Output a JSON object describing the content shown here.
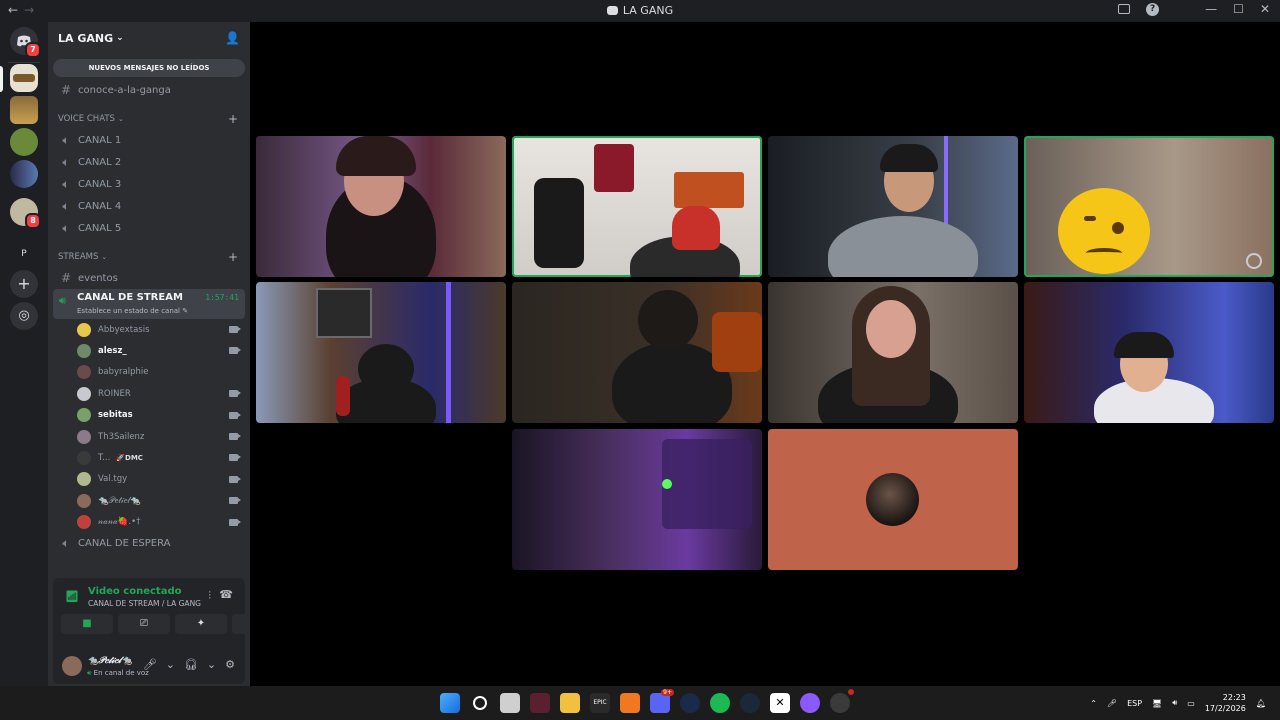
{
  "window": {
    "title": "LA GANG",
    "nav_back": "←",
    "nav_forward": "→",
    "min": "—",
    "max": "☐",
    "close": "✕"
  },
  "rail": {
    "dm_badge": "7",
    "server_badge": "8",
    "server_letter": "P",
    "add": "+",
    "explore": "◎"
  },
  "guild": {
    "name": "LA GANG",
    "unread_banner": "NUEVOS MENSAJES NO LEÍDOS",
    "pinned_channel": "conoce-a-la-ganga"
  },
  "voice_category": {
    "label": "VOICE CHATS",
    "channels": [
      "CANAL 1",
      "CANAL 2",
      "CANAL 3",
      "CANAL 4",
      "CANAL 5"
    ]
  },
  "streams_category": {
    "label": "STREAMS",
    "text_channel": "eventos",
    "active_channel": {
      "name": "CANAL DE STREAM",
      "status_hint": "Establece un estado de canal",
      "timer": "1:57:41"
    },
    "members": [
      {
        "name": "Abbyextasis",
        "bold": false,
        "cam": true,
        "color": "#e8c84a"
      },
      {
        "name": "alesz_",
        "bold": true,
        "cam": true,
        "color": "#6f8a6a"
      },
      {
        "name": "babyralphie",
        "bold": false,
        "cam": false,
        "color": "#6a4a4a"
      },
      {
        "name": "ROINER",
        "bold": false,
        "cam": true,
        "color": "#c8c8d0"
      },
      {
        "name": "sebitas",
        "bold": true,
        "cam": true,
        "color": "#7aa06a"
      },
      {
        "name": "Th3Sailenz",
        "bold": false,
        "cam": true,
        "color": "#8a7a8a"
      },
      {
        "name": "T...",
        "bold": false,
        "cam": true,
        "color": "#3a3a3a",
        "tag": "🚀DMC"
      },
      {
        "name": "Val.tgy",
        "bold": false,
        "cam": true,
        "color": "#b0b890"
      },
      {
        "name": "🐀𝒫𝑒𝓉𝒾𝑒𝓁🐀",
        "bold": false,
        "cam": true,
        "color": "#8b6a5a"
      },
      {
        "name": "𝓃𝒶𝓃𝒶🍓.•†",
        "bold": false,
        "cam": true,
        "color": "#c04040"
      }
    ],
    "waiting_channel": "CANAL DE ESPERA"
  },
  "voice_panel": {
    "status": "Video conectado",
    "location": "CANAL DE STREAM / LA GANG"
  },
  "user": {
    "name": "🐀𝒫𝑒𝓉𝒾𝑒𝓁🐀",
    "status": "En canal de voz"
  },
  "taskbar": {
    "lang": "ESP",
    "time": "22:23",
    "date": "17/2/2026",
    "discord_badge": "9+"
  }
}
